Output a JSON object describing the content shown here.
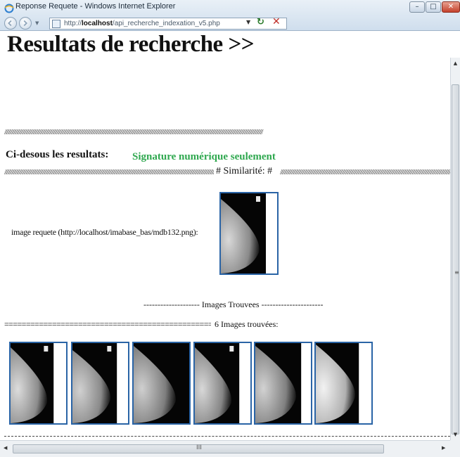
{
  "window": {
    "title": "Reponse Requete - Windows Internet Explorer",
    "minimize_glyph": "–",
    "maximize_glyph": "□",
    "close_glyph": "✕"
  },
  "toolbar": {
    "url_prefix": "http://",
    "url_host": "localhost",
    "url_path": "/api_recherche_indexation_v5.php",
    "refresh_glyph": "↻",
    "stop_glyph": "✕",
    "dropdown_glyph": "▼",
    "icons": [
      "back-icon",
      "forward-icon",
      "page-icon",
      "refresh-icon",
      "stop-icon"
    ]
  },
  "page": {
    "title": "Resultats de recherche >>",
    "separator": "////////////////////////////////////////////////////////////////////////////////////////////////////////////////////////////////////////////////////////////////////////////////////////////////////////////////////////////////////////////////////////////",
    "results_heading": "Ci-desous les resultats:",
    "signature_label": "Signature numérique seulement",
    "similarity_label": "# Similarité: #",
    "query_label": "image requete (http://localhost/imabase_bas/mdb132.png):",
    "found_header": "-------------------- Images Trouvees ----------------------",
    "equals_line": "==============================================================",
    "found_count": "6 Images trouvées:",
    "result_count": 6,
    "dashed_line": "",
    "colors": {
      "signature_green": "#2fa84f",
      "thumb_border_blue": "#2a64a6"
    }
  },
  "scrollbars": {
    "up_glyph": "▲",
    "down_glyph": "▼",
    "left_glyph": "◀",
    "right_glyph": "▶",
    "v_grip": "≡",
    "h_grip": "III"
  }
}
